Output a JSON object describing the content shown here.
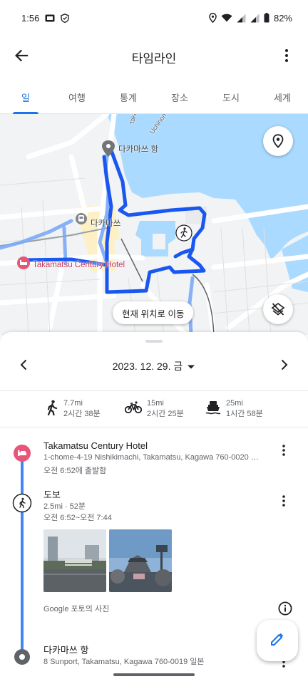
{
  "status": {
    "time": "1:56",
    "battery": "82%",
    "icons": [
      "sim-icon",
      "shield-icon",
      "location-icon",
      "wifi-icon",
      "signal-icon",
      "signal-icon",
      "battery-icon"
    ]
  },
  "appbar": {
    "title": "타임라인",
    "back_icon": "arrow-back-icon",
    "more_icon": "more-vert-icon"
  },
  "tabs": [
    {
      "label": "일",
      "active": true
    },
    {
      "label": "여행"
    },
    {
      "label": "통계"
    },
    {
      "label": "장소"
    },
    {
      "label": "도시"
    },
    {
      "label": "세계"
    }
  ],
  "map": {
    "labels": {
      "port": "다카마쓰 항",
      "station": "다카마쓰",
      "hotel": "Takamatsu Century Hotel",
      "street1": "Takam",
      "street2": "Uchinon"
    },
    "current_location_button": "현재 위치로 이동",
    "colors": {
      "route": "#1a57f0",
      "water": "#aadaff",
      "land": "#f1f3f4",
      "hotel": "#e8557a"
    }
  },
  "date_nav": {
    "date": "2023. 12. 29. 금"
  },
  "summary": [
    {
      "icon": "walk-icon",
      "distance": "7.7mi",
      "duration": "2시간 38분"
    },
    {
      "icon": "bike-icon",
      "distance": "15mi",
      "duration": "2시간 25분"
    },
    {
      "icon": "ferry-icon",
      "distance": "25mi",
      "duration": "1시간 58분"
    }
  ],
  "timeline": {
    "hotel": {
      "title": "Takamatsu Century Hotel",
      "address": "1-chome-4-19 Nishikimachi, Takamatsu, Kagawa 760-0020 …",
      "time": "오전 6:52에 출발함"
    },
    "walk": {
      "title": "도보",
      "detail": "2.5mi · 52분",
      "time": "오전 6:52~오전 7:44"
    },
    "photos_caption": "Google 포토의 사진",
    "port": {
      "title": "다카마쓰 항",
      "address": "8 Sunport, Takamatsu, Kagawa 760-0019 일본"
    }
  }
}
